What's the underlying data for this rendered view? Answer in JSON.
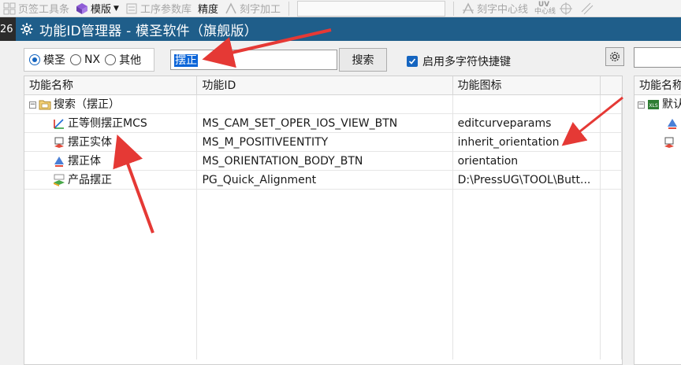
{
  "toolbar": {
    "page_tools": "页签工具条",
    "template": "模版",
    "process_lib": "工序参数库",
    "precision": "精度",
    "engrave": "刻字加工",
    "engrave_center": "刻字中心线",
    "uv_top": "UV",
    "uv_bottom": "中心线"
  },
  "title": {
    "left_fragment": "26",
    "text": "功能ID管理器 - 模圣软件（旗舰版）"
  },
  "search": {
    "radios": [
      {
        "label": "模圣",
        "checked": true
      },
      {
        "label": "NX",
        "checked": false
      },
      {
        "label": "其他",
        "checked": false
      }
    ],
    "value": "摆正",
    "button": "搜索",
    "checkbox_label": "启用多字符快捷键",
    "checkbox_checked": true
  },
  "table": {
    "columns": [
      "功能名称",
      "功能ID",
      "功能图标"
    ],
    "group": {
      "label": "搜索（摆正）",
      "expanded": true
    },
    "rows": [
      {
        "name": "正等侧摆正MCS",
        "id": "MS_CAM_SET_OPER_IOS_VIEW_BTN",
        "icon": "editcurveparams",
        "icon_name": "csys-icon"
      },
      {
        "name": "摆正实体",
        "id": "MS_M_POSITIVEENTITY",
        "icon": "inherit_orientation",
        "icon_name": "solid-orient-icon"
      },
      {
        "name": "摆正体",
        "id": "MS_ORIENTATION_BODY_BTN",
        "icon": "orientation",
        "icon_name": "orientation-icon"
      },
      {
        "name": "产品摆正",
        "id": "PG_Quick_Alignment",
        "icon": "D:\\PressUG\\TOOL\\Butt...",
        "icon_name": "quick-align-icon"
      }
    ],
    "empty_rows": 9
  },
  "right_panel": {
    "column": "功能名称",
    "group_label": "默认"
  },
  "colors": {
    "title_bar": "#1f5e8a",
    "accent": "#1565c0",
    "annotation": "#e53935"
  }
}
